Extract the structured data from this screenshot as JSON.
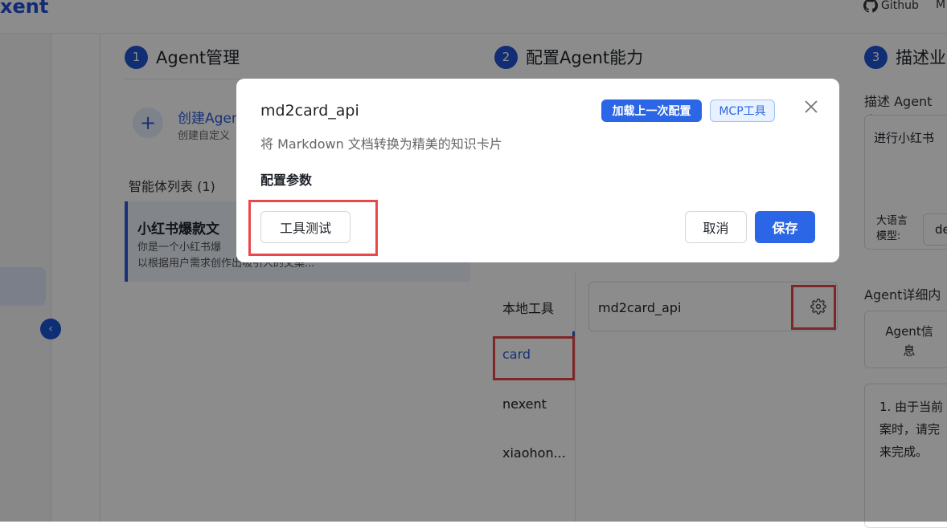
{
  "header": {
    "brand": "xent",
    "links": [
      {
        "label": "Github",
        "icon": "github-icon"
      },
      {
        "label": "M"
      }
    ]
  },
  "steps": [
    {
      "num": "1",
      "title": "Agent管理"
    },
    {
      "num": "2",
      "title": "配置Agent能力"
    },
    {
      "num": "3",
      "title": "描述业"
    }
  ],
  "agent_panel": {
    "create_title": "创建Agen",
    "create_subtitle": "创建自定义",
    "list_title": "智能体列表 (1)",
    "selected_agent": {
      "name": "小红书爆款文",
      "desc_line1": "你是一个小红书爆",
      "desc_line2": "以根据用户需求创作出吸引人的文案..."
    }
  },
  "tools_panel": {
    "categories": [
      "本地工具",
      "card",
      "nexent",
      "xiaohon..."
    ],
    "active_category": "card",
    "tool_name": "md2card_api"
  },
  "describe_panel": {
    "label": "描述 Agent 应",
    "text": "进行小红书",
    "model_label": "大语言\n模型:",
    "model_value": "de",
    "detail_title": "Agent详细内",
    "tab": "Agent信\n息",
    "detail_text": "1. 由于当前\n案时，请完\n来完成。"
  },
  "modal": {
    "title": "md2card_api",
    "load_last_config": "加载上一次配置",
    "mcp_badge": "MCP工具",
    "description": "将 Markdown 文档转换为精美的知识卡片",
    "section_title": "配置参数",
    "test_button": "工具测试",
    "cancel_button": "取消",
    "save_button": "保存"
  },
  "colors": {
    "accent": "#1f55d4",
    "primary_button": "#2b66e6",
    "highlight_box": "#e8484a"
  }
}
